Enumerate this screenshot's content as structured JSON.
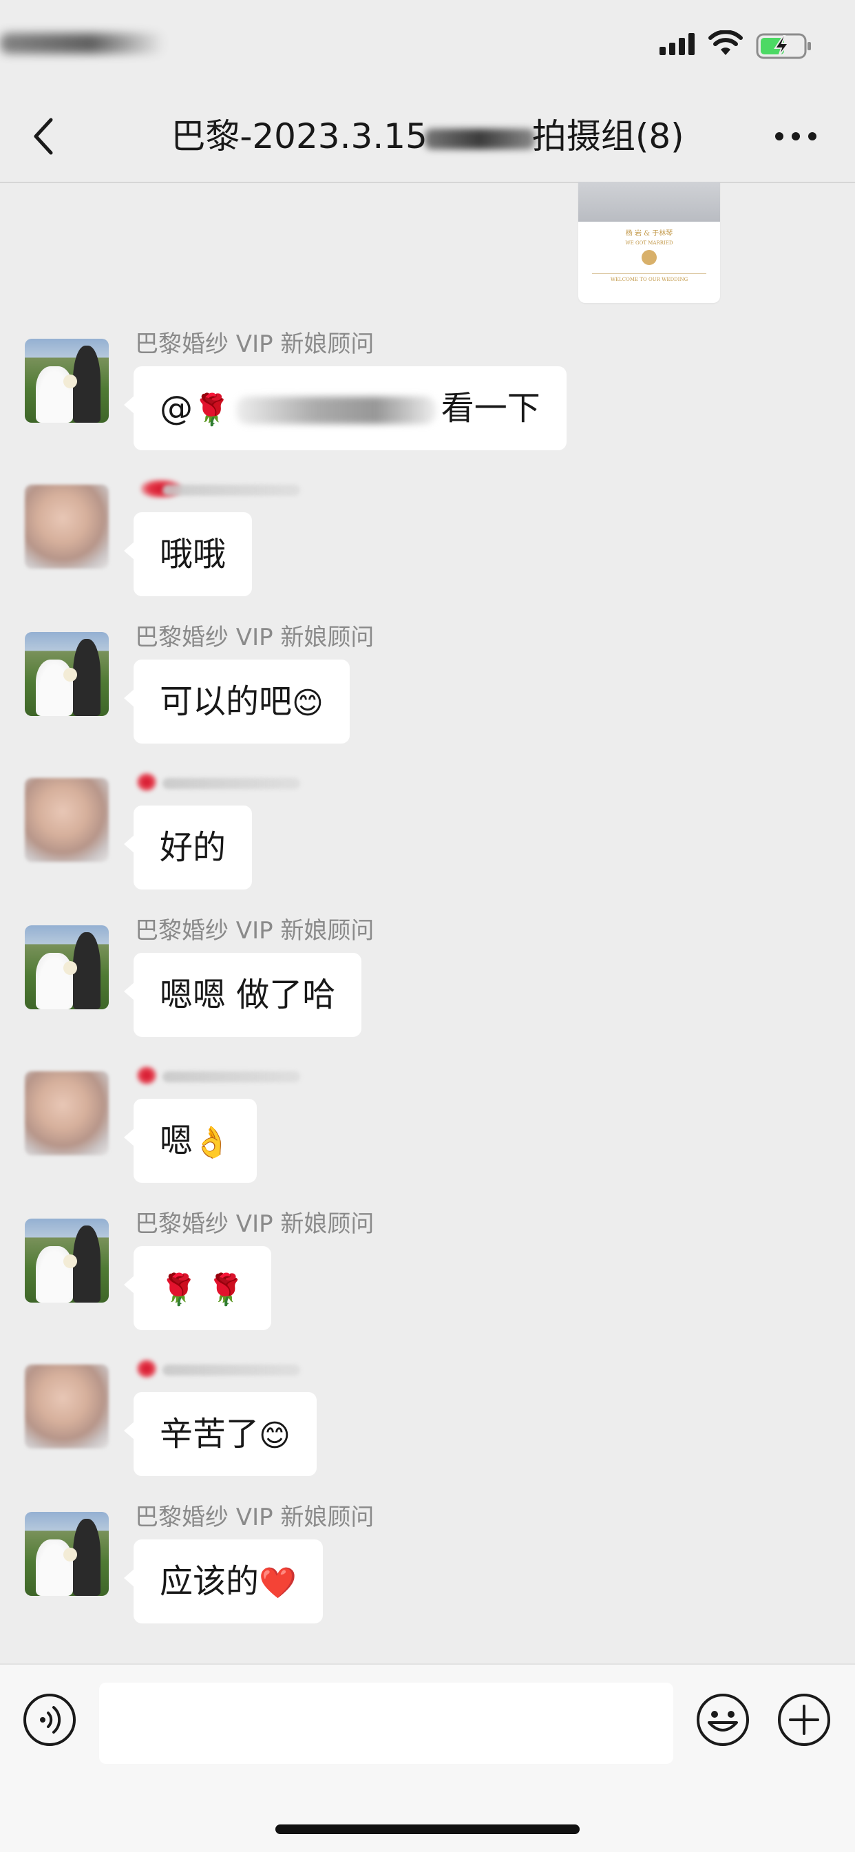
{
  "chat": {
    "title_prefix": "巴黎-2023.3.15",
    "title_suffix": "拍摄组(8)"
  },
  "image_card": {
    "names": "杨 岩  &  于林琴",
    "sub": "WE GOT MARRIED",
    "welcome": "WELCOME TO OUR WEDDING"
  },
  "messages": [
    {
      "sender": "巴黎婚纱 VIP 新娘顾问",
      "prefix": "@",
      "emoji": "🌹",
      "suffix": "看一下"
    },
    {
      "sender": "",
      "text": "哦哦"
    },
    {
      "sender": "巴黎婚纱 VIP 新娘顾问",
      "text": "可以的吧",
      "emoji": "😊"
    },
    {
      "sender": "",
      "text": "好的"
    },
    {
      "sender": "巴黎婚纱 VIP 新娘顾问",
      "text": "嗯嗯 做了哈"
    },
    {
      "sender": "",
      "text": "嗯",
      "emoji": "👌"
    },
    {
      "sender": "巴黎婚纱 VIP 新娘顾问",
      "text": "",
      "emoji": "🌹 🌹"
    },
    {
      "sender": "",
      "text": "辛苦了",
      "emoji": "😊"
    },
    {
      "sender": "巴黎婚纱 VIP 新娘顾问",
      "text": "应该的",
      "emoji": "❤️"
    }
  ],
  "icons": {
    "back": "chevron-left-icon",
    "more": "more-icon",
    "voice": "voice-icon",
    "emoji": "emoji-icon",
    "plus": "plus-icon"
  }
}
